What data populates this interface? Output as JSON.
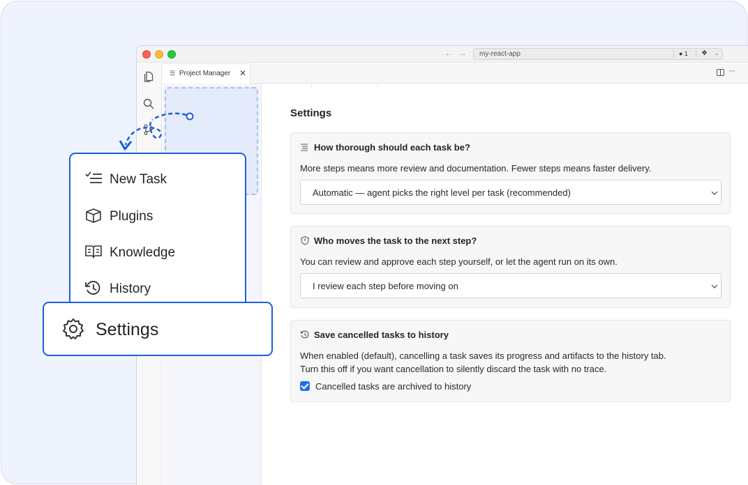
{
  "window": {
    "address": "my-react-app",
    "address_badge": "● 1",
    "address_copilot": "❖",
    "address_chevron": "⌄",
    "nav_back": "←",
    "nav_forward": "→"
  },
  "tab": {
    "icon": "☰",
    "label": "Project Manager",
    "close": "✕"
  },
  "tabbar": {
    "more": "···"
  },
  "settings": {
    "title": "Settings",
    "sections": [
      {
        "icon": "list-icon",
        "heading": "How thorough should each task be?",
        "description": "More steps means more review and documentation. Fewer steps means faster delivery.",
        "select_value": "Automatic — agent picks the right level per task (recommended)"
      },
      {
        "icon": "shield-icon",
        "heading": "Who moves the task to the next step?",
        "description": "You can review and approve each step yourself, or let the agent run on its own.",
        "select_value": "I review each step before moving on"
      },
      {
        "icon": "history-icon",
        "heading": "Save cancelled tasks to history",
        "description_line1": "When enabled (default), cancelling a task saves its progress and artifacts to the history tab.",
        "description_line2": "Turn this off if you want cancellation to silently discard the task with no trace.",
        "checkbox_label": "Cancelled tasks are archived to history",
        "checkbox_checked": true
      }
    ]
  },
  "overlay_menu": {
    "items": [
      {
        "label": "New Task",
        "icon": "checklist-icon"
      },
      {
        "label": "Plugins",
        "icon": "cube-icon"
      },
      {
        "label": "Knowledge",
        "icon": "book-icon"
      },
      {
        "label": "History",
        "icon": "history-icon"
      }
    ],
    "highlight": {
      "label": "Settings",
      "icon": "gear-icon"
    }
  },
  "colors": {
    "accent": "#1a5fd6",
    "checkbox": "#1f6feb",
    "backdrop": "#eef3fd"
  }
}
